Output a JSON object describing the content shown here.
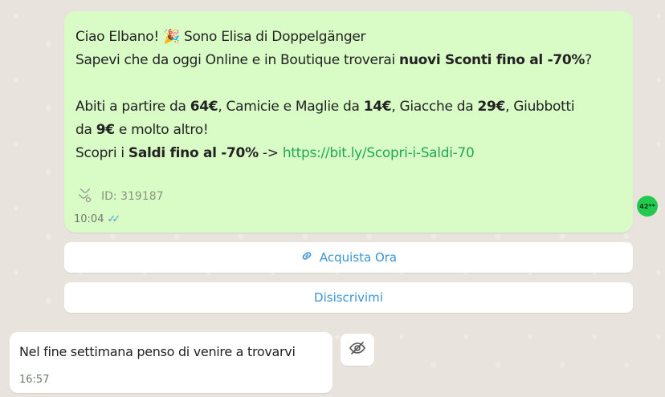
{
  "message_out": {
    "line1": "Ciao Elbano! 🎉 Sono Elisa di Doppelgänger",
    "line2_a": "Sapevi che da oggi Online e in Boutique troverai ",
    "line2_b": "nuovi Sconti fino al -70%",
    "line2_c": "?",
    "line3_a": "Abiti a partire da ",
    "line3_b": "64€",
    "line3_c": ", Camicie e Maglie da ",
    "line3_d": "14€",
    "line3_e": ", Giacche da ",
    "line3_f": "29€",
    "line3_g": ", Giubbotti",
    "line4_a": "da ",
    "line4_b": "9€",
    "line4_c": " e molto altro!",
    "line5_a": "Scopri i ",
    "line5_b": "Saldi fino al -70%",
    "line5_c": " -> ",
    "link": "https://bit.ly/Scopri-i-Saldi-70",
    "id_label": "ID: 319187",
    "time": "10:04",
    "avatar_text": "42**"
  },
  "buttons": {
    "buy_label": "Acquista Ora",
    "unsubscribe_label": "Disiscrivimi"
  },
  "message_in": {
    "text": "Nel fine settimana penso di venire a trovarvi",
    "time": "16:57"
  },
  "icons": {
    "link": "link-icon",
    "id": "message-id-icon",
    "ticks": "double-check-icon",
    "eye": "eye-off-icon"
  },
  "colors": {
    "outgoing_bubble": "#d9fcc6",
    "link": "#1fa855",
    "button_text": "#3a95d6",
    "background": "#e8e3dc"
  }
}
